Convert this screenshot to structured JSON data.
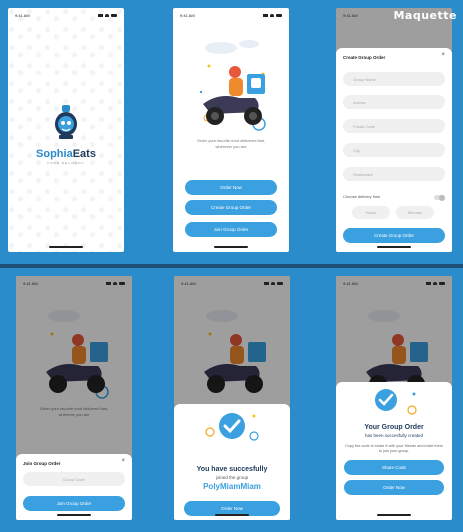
{
  "watermark": "Maquette",
  "status": {
    "time": "9:41 AM"
  },
  "splash": {
    "brand_part1": "Sophia",
    "brand_part2": "Eats",
    "tagline": "FOOD DELIVERY"
  },
  "home": {
    "tagline": "Order your favorite food delivered fast, wherever you are",
    "order_now": "Order Now",
    "create_group_order": "Create Group Order",
    "join_group_order": "Join Group Order"
  },
  "create_sheet": {
    "title": "Create Group Order",
    "close": "×",
    "fields": [
      "Group Name",
      "Adress",
      "Postal Code",
      "City",
      "Restaurant"
    ],
    "delivery_label": "Choose delivery time",
    "hours": "Hours",
    "minutes": "Minutes",
    "submit": "Create Group Order"
  },
  "join_sheet": {
    "title": "Join Group Order",
    "close": "×",
    "code_placeholder": "Group Code",
    "submit": "Join Group Order"
  },
  "joined": {
    "title": "You have succesfully",
    "subtitle": "joined the group",
    "group_name": "PolyMiamMiam",
    "button": "Order Now"
  },
  "created": {
    "title": "Your Group Order",
    "subtitle": "has been succesfully created",
    "description": "Copy the code to share it with your friends and invite them to join your group.",
    "share": "Share Code",
    "order": "Order Now"
  },
  "colors": {
    "accent": "#3aa0e0",
    "navy": "#1e3a5c",
    "background": "#2a8ccb"
  }
}
